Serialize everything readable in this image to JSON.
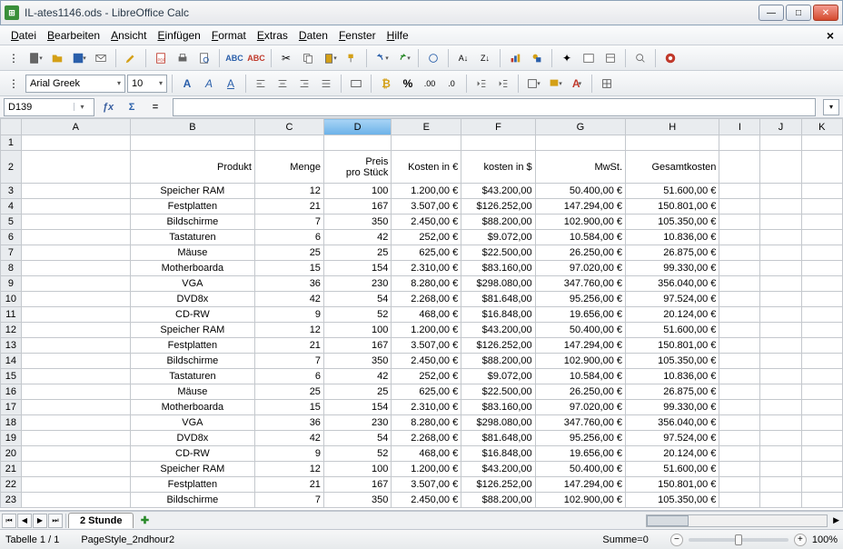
{
  "window": {
    "title": "IL-ates1146.ods - LibreOffice Calc"
  },
  "menu": [
    "Datei",
    "Bearbeiten",
    "Ansicht",
    "Einfügen",
    "Format",
    "Extras",
    "Daten",
    "Fenster",
    "Hilfe"
  ],
  "font": {
    "name": "Arial Greek",
    "size": "10"
  },
  "namebox": "D139",
  "columns": [
    "A",
    "B",
    "C",
    "D",
    "E",
    "F",
    "G",
    "H",
    "I",
    "J",
    "K"
  ],
  "selected_col_index": 3,
  "header": {
    "produkt": "Produkt",
    "menge": "Menge",
    "preis1": "Preis",
    "preis2": "pro Stück",
    "kosten_eur": "Kosten in €",
    "kosten_usd": "kosten in $",
    "mwst": "MwSt.",
    "gesamt": "Gesamtkosten"
  },
  "rows": [
    {
      "n": 3,
      "p": "Speicher RAM",
      "m": "12",
      "pp": "100",
      "ke": "1.200,00 €",
      "ku": "$43.200,00",
      "mw": "50.400,00 €",
      "g": "51.600,00 €"
    },
    {
      "n": 4,
      "p": "Festplatten",
      "m": "21",
      "pp": "167",
      "ke": "3.507,00 €",
      "ku": "$126.252,00",
      "mw": "147.294,00 €",
      "g": "150.801,00 €"
    },
    {
      "n": 5,
      "p": "Bildschirme",
      "m": "7",
      "pp": "350",
      "ke": "2.450,00 €",
      "ku": "$88.200,00",
      "mw": "102.900,00 €",
      "g": "105.350,00 €"
    },
    {
      "n": 6,
      "p": "Tastaturen",
      "m": "6",
      "pp": "42",
      "ke": "252,00 €",
      "ku": "$9.072,00",
      "mw": "10.584,00 €",
      "g": "10.836,00 €"
    },
    {
      "n": 7,
      "p": "Mäuse",
      "m": "25",
      "pp": "25",
      "ke": "625,00 €",
      "ku": "$22.500,00",
      "mw": "26.250,00 €",
      "g": "26.875,00 €"
    },
    {
      "n": 8,
      "p": "Motherboarda",
      "m": "15",
      "pp": "154",
      "ke": "2.310,00 €",
      "ku": "$83.160,00",
      "mw": "97.020,00 €",
      "g": "99.330,00 €"
    },
    {
      "n": 9,
      "p": "VGA",
      "m": "36",
      "pp": "230",
      "ke": "8.280,00 €",
      "ku": "$298.080,00",
      "mw": "347.760,00 €",
      "g": "356.040,00 €"
    },
    {
      "n": 10,
      "p": "DVD8x",
      "m": "42",
      "pp": "54",
      "ke": "2.268,00 €",
      "ku": "$81.648,00",
      "mw": "95.256,00 €",
      "g": "97.524,00 €"
    },
    {
      "n": 11,
      "p": "CD-RW",
      "m": "9",
      "pp": "52",
      "ke": "468,00 €",
      "ku": "$16.848,00",
      "mw": "19.656,00 €",
      "g": "20.124,00 €"
    },
    {
      "n": 12,
      "p": "Speicher RAM",
      "m": "12",
      "pp": "100",
      "ke": "1.200,00 €",
      "ku": "$43.200,00",
      "mw": "50.400,00 €",
      "g": "51.600,00 €"
    },
    {
      "n": 13,
      "p": "Festplatten",
      "m": "21",
      "pp": "167",
      "ke": "3.507,00 €",
      "ku": "$126.252,00",
      "mw": "147.294,00 €",
      "g": "150.801,00 €"
    },
    {
      "n": 14,
      "p": "Bildschirme",
      "m": "7",
      "pp": "350",
      "ke": "2.450,00 €",
      "ku": "$88.200,00",
      "mw": "102.900,00 €",
      "g": "105.350,00 €"
    },
    {
      "n": 15,
      "p": "Tastaturen",
      "m": "6",
      "pp": "42",
      "ke": "252,00 €",
      "ku": "$9.072,00",
      "mw": "10.584,00 €",
      "g": "10.836,00 €"
    },
    {
      "n": 16,
      "p": "Mäuse",
      "m": "25",
      "pp": "25",
      "ke": "625,00 €",
      "ku": "$22.500,00",
      "mw": "26.250,00 €",
      "g": "26.875,00 €"
    },
    {
      "n": 17,
      "p": "Motherboarda",
      "m": "15",
      "pp": "154",
      "ke": "2.310,00 €",
      "ku": "$83.160,00",
      "mw": "97.020,00 €",
      "g": "99.330,00 €"
    },
    {
      "n": 18,
      "p": "VGA",
      "m": "36",
      "pp": "230",
      "ke": "8.280,00 €",
      "ku": "$298.080,00",
      "mw": "347.760,00 €",
      "g": "356.040,00 €"
    },
    {
      "n": 19,
      "p": "DVD8x",
      "m": "42",
      "pp": "54",
      "ke": "2.268,00 €",
      "ku": "$81.648,00",
      "mw": "95.256,00 €",
      "g": "97.524,00 €"
    },
    {
      "n": 20,
      "p": "CD-RW",
      "m": "9",
      "pp": "52",
      "ke": "468,00 €",
      "ku": "$16.848,00",
      "mw": "19.656,00 €",
      "g": "20.124,00 €"
    },
    {
      "n": 21,
      "p": "Speicher RAM",
      "m": "12",
      "pp": "100",
      "ke": "1.200,00 €",
      "ku": "$43.200,00",
      "mw": "50.400,00 €",
      "g": "51.600,00 €"
    },
    {
      "n": 22,
      "p": "Festplatten",
      "m": "21",
      "pp": "167",
      "ke": "3.507,00 €",
      "ku": "$126.252,00",
      "mw": "147.294,00 €",
      "g": "150.801,00 €"
    },
    {
      "n": 23,
      "p": "Bildschirme",
      "m": "7",
      "pp": "350",
      "ke": "2.450,00 €",
      "ku": "$88.200,00",
      "mw": "102.900,00 €",
      "g": "105.350,00 €"
    }
  ],
  "sheet_tab": "2 Stunde",
  "status": {
    "sheet": "Tabelle 1 / 1",
    "style": "PageStyle_2ndhour2",
    "sum": "Summe=0",
    "zoom": "100%"
  }
}
